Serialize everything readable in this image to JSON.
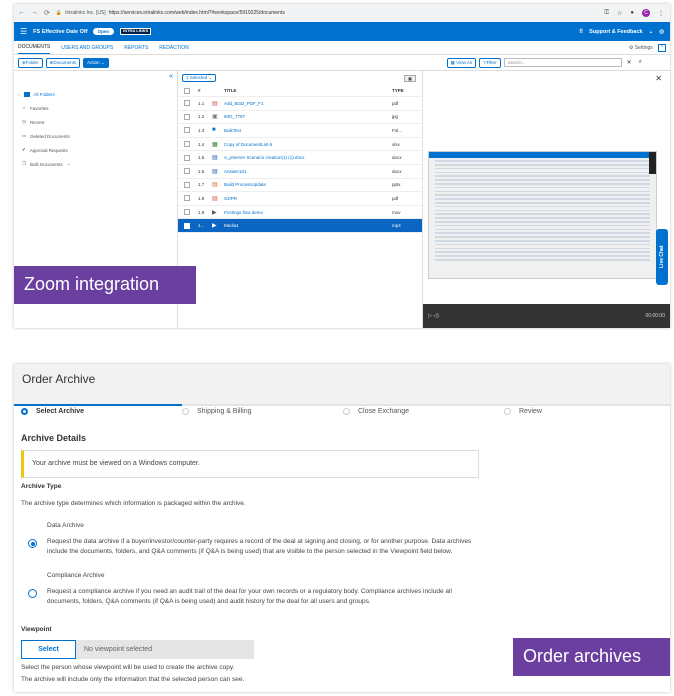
{
  "top_screenshot": {
    "browser": {
      "site": "Intralinks Inc. [US]",
      "url": "https://services.intralinks.com/web/index.html?#workspace/5919225/documents",
      "avatar_letter": "C"
    },
    "appbar": {
      "room_name": "FS Effective Date Off",
      "status_pill": "Open",
      "logo": "INTRA LINKS",
      "support": "Support & Feedback"
    },
    "tabs": [
      "DOCUMENTS",
      "USERS AND GROUPS",
      "REPORTS",
      "REDACTION"
    ],
    "settings_label": "Settings",
    "toolbar": {
      "folder_btn": "Folder",
      "documents_btn": "Documents",
      "action_btn": "Action",
      "view_as": "View As",
      "filter": "Filter",
      "search_placeholder": "Search..."
    },
    "tree": {
      "all_folders": "All Folders",
      "items": [
        "Favorites",
        "Recent",
        "Deleted Documents",
        "Approval Requests",
        "Bulk Documents"
      ]
    },
    "list": {
      "selected_label": "1 Selected",
      "headers": {
        "num": "#",
        "title": "TITLE",
        "type": "TYPE"
      },
      "rows": [
        {
          "num": "1.1",
          "title": "Add_BGD_PDF_F1",
          "type": "pdf",
          "icon": "pdf-icon"
        },
        {
          "num": "1.2",
          "title": "IMG_7797",
          "type": "jpg",
          "icon": "image-icon"
        },
        {
          "num": "1.3",
          "title": "BulkTest",
          "type": "Fol...",
          "icon": "folder-icon"
        },
        {
          "num": "1.4",
          "title": "Copy of DocumentList-5",
          "type": "xlsx",
          "icon": "excel-icon"
        },
        {
          "num": "1.5",
          "title": "A_pServer Scenario creation(1) (1).docx",
          "type": "docx",
          "icon": "word-icon"
        },
        {
          "num": "1.6",
          "title": "Answer101",
          "type": "docx",
          "icon": "word-icon"
        },
        {
          "num": "1.7",
          "title": "Build ProcessUpdate",
          "type": "pptx",
          "icon": "ppt-icon"
        },
        {
          "num": "1.8",
          "title": "GDPR",
          "type": "pdf",
          "icon": "pdf-icon"
        },
        {
          "num": "1.9",
          "title": "Postings flow demo",
          "type": "mov",
          "icon": "video-icon"
        },
        {
          "num": "1...",
          "title": "Media1",
          "type": "mp4",
          "icon": "video-icon"
        }
      ]
    },
    "player_time": "00:00:00",
    "live_chat": "Live Chat",
    "caption": "Zoom integration"
  },
  "bottom_screenshot": {
    "title": "Order Archive",
    "steps": [
      "Select Archive",
      "Shipping & Billing",
      "Close Exchange",
      "Review"
    ],
    "section_title": "Archive Details",
    "notice": "Your archive must be viewed on a Windows computer.",
    "archive_type_label": "Archive Type",
    "archive_type_help": "The archive type determines which information is packaged within the archive.",
    "options": [
      {
        "label": "Data Archive",
        "desc_line1": "Request the data archive if a buyer/investor/counter-party requires a record of the deal at signing and closing, or for another purpose. Data archives",
        "desc_line2": "include the documents, folders, and Q&A comments (if Q&A is being used) that are visible to the person selected in the Viewpoint field below."
      },
      {
        "label": "Compliance Archive",
        "desc_line1": "Request a compliance archive if you need an audit trail of the deal for your own records or a regulatory body. Compliance archives include all",
        "desc_line2": "documents, folders, Q&A comments (if Q&A is being used) and audit history for the deal for all users and groups."
      }
    ],
    "viewpoint_label": "Viewpoint",
    "select_btn": "Select",
    "no_viewpoint": "No viewpoint selected",
    "viewpoint_help1": "Select the person whose viewpoint will be used to create the archive copy.",
    "viewpoint_help2": "The archive will include only the information that the selected person can see.",
    "caption": "Order archives"
  }
}
